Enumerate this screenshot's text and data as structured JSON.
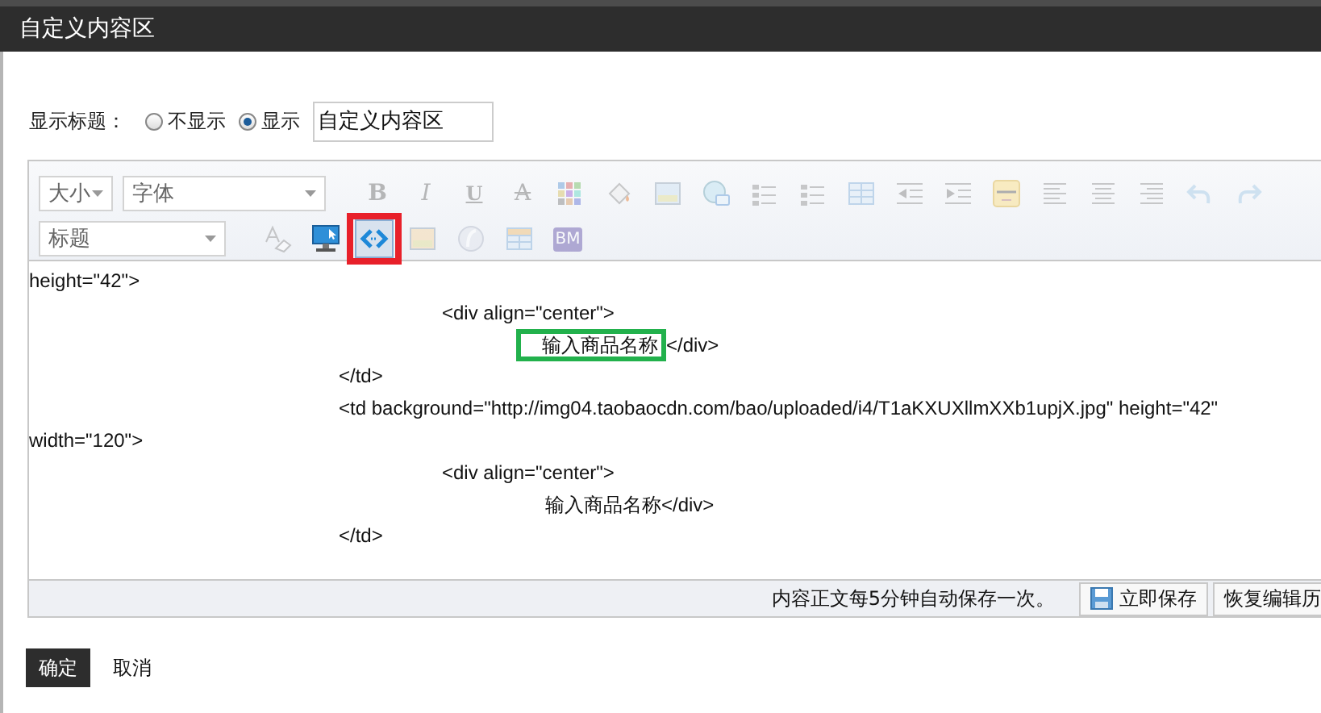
{
  "window": {
    "title": "自定义内容区"
  },
  "title_setting": {
    "label": "显示标题：",
    "options": [
      {
        "label": "不显示",
        "selected": false
      },
      {
        "label": "显示",
        "selected": true
      }
    ],
    "value": "自定义内容区"
  },
  "toolbar": {
    "rows": [
      {
        "selects": [
          {
            "label": "大小",
            "kind": "small"
          },
          {
            "label": "字体",
            "kind": "wide"
          }
        ],
        "buttons": [
          {
            "kind": "letter",
            "glyph": "B",
            "disabled": true,
            "pressed": false,
            "marked": false
          },
          {
            "kind": "italic",
            "glyph": "I",
            "disabled": true,
            "pressed": false,
            "marked": false
          },
          {
            "kind": "underline",
            "glyph": "U",
            "disabled": true,
            "pressed": false,
            "marked": false
          },
          {
            "kind": "strike",
            "glyph": "A",
            "disabled": true,
            "pressed": false,
            "marked": false
          },
          {
            "kind": "color-grid",
            "disabled": true,
            "pressed": false,
            "marked": false
          },
          {
            "kind": "fill",
            "disabled": true,
            "pressed": false,
            "marked": false
          },
          {
            "kind": "image",
            "disabled": true,
            "pressed": false,
            "marked": false
          },
          {
            "kind": "link",
            "disabled": true,
            "pressed": false,
            "marked": false
          },
          {
            "kind": "bullet-list",
            "disabled": true,
            "pressed": false,
            "marked": false
          },
          {
            "kind": "number-list",
            "disabled": true,
            "pressed": false,
            "marked": false
          },
          {
            "kind": "table",
            "disabled": true,
            "pressed": false,
            "marked": false
          },
          {
            "kind": "outdent",
            "disabled": true,
            "pressed": false,
            "marked": false
          },
          {
            "kind": "indent",
            "disabled": true,
            "pressed": false,
            "marked": false
          },
          {
            "kind": "emoticon",
            "disabled": true,
            "pressed": false,
            "marked": false
          },
          {
            "kind": "align-left",
            "disabled": true,
            "pressed": false,
            "marked": false
          },
          {
            "kind": "align-center",
            "disabled": true,
            "pressed": false,
            "marked": false
          },
          {
            "kind": "align-right",
            "disabled": true,
            "pressed": false,
            "marked": false
          },
          {
            "kind": "undo",
            "disabled": true,
            "pressed": false,
            "marked": false
          },
          {
            "kind": "redo",
            "disabled": true,
            "pressed": false,
            "marked": false
          }
        ]
      },
      {
        "selects": [
          {
            "label": "标题",
            "kind": "medium"
          }
        ],
        "buttons": [
          {
            "kind": "clear-format",
            "disabled": true,
            "pressed": false,
            "marked": false
          },
          {
            "kind": "preview",
            "disabled": false,
            "pressed": false,
            "marked": false
          },
          {
            "kind": "source",
            "disabled": false,
            "pressed": true,
            "marked": true
          },
          {
            "kind": "media",
            "disabled": true,
            "pressed": false,
            "marked": false
          },
          {
            "kind": "flash",
            "disabled": true,
            "pressed": false,
            "marked": false
          },
          {
            "kind": "layout",
            "disabled": true,
            "pressed": false,
            "marked": false
          },
          {
            "kind": "letter-badge",
            "glyph": "BM",
            "disabled": true,
            "pressed": false,
            "marked": false
          }
        ]
      }
    ]
  },
  "code_lines": [
    {
      "parts": [
        {
          "text": "height=\"42\">",
          "boxed": false
        }
      ]
    },
    {
      "parts": [
        {
          "text": "\t\t\t\t<div align=\"center\">",
          "boxed": false
        }
      ]
    },
    {
      "parts": [
        {
          "text": "输入商品名称",
          "boxed": true
        },
        {
          "text": "</div>",
          "boxed": false
        }
      ]
    },
    {
      "parts": [
        {
          "text": "\t\t\t</td>",
          "boxed": false
        }
      ]
    },
    {
      "parts": [
        {
          "text": "\t\t\t<td background=\"http://img04.taobaocdn.com/bao/uploaded/i4/T1aKXUXllmXXb1upjX.jpg\" height=\"42\"",
          "boxed": false
        }
      ]
    },
    {
      "parts": [
        {
          "text": "width=\"120\">",
          "boxed": false
        }
      ]
    },
    {
      "parts": [
        {
          "text": "\t\t\t\t<div align=\"center\">",
          "boxed": false
        }
      ]
    },
    {
      "parts": [
        {
          "text": "\t\t\t\t\t输入商品名称</div>",
          "boxed": false
        }
      ]
    },
    {
      "parts": [
        {
          "text": "\t\t\t</td>",
          "boxed": false
        }
      ]
    }
  ],
  "status_bar": {
    "note": "内容正文每5分钟自动保存一次。",
    "buttons": [
      {
        "label": "立即保存",
        "kind": "save"
      },
      {
        "label": "恢复编辑历",
        "kind": "plain"
      }
    ]
  },
  "footer": {
    "buttons": [
      {
        "label": "确定",
        "kind": "primary"
      },
      {
        "label": "取消",
        "kind": "plain"
      }
    ]
  }
}
